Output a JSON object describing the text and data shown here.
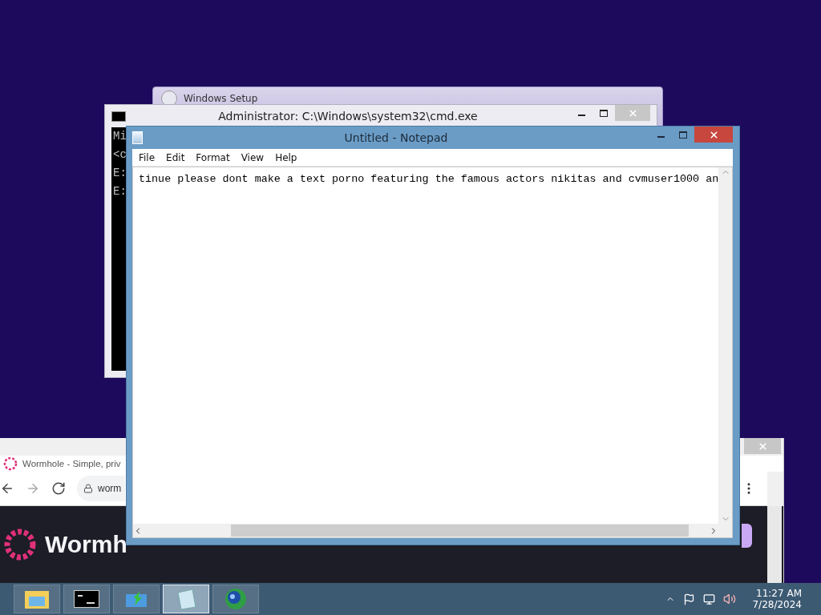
{
  "setup_window": {
    "title": "Windows Setup"
  },
  "cmd_window": {
    "title": "Administrator: C:\\Windows\\system32\\cmd.exe",
    "lines": [
      "Mi",
      "<c",
      "E:",
      "E:"
    ]
  },
  "browser_window": {
    "tab_title": "Wormhole - Simple, priv",
    "address": "worm",
    "brand": "Wormh"
  },
  "notepad": {
    "title": "Untitled - Notepad",
    "menu": [
      "File",
      "Edit",
      "Format",
      "View",
      "Help"
    ],
    "text": "tinue please dont make a text porno featuring the famous actors nikitas and cvmuser1000 an"
  },
  "taskbar": {
    "items": [
      {
        "kind": "explorer",
        "selected": false
      },
      {
        "kind": "console",
        "selected": false
      },
      {
        "kind": "setup",
        "selected": false
      },
      {
        "kind": "notepad",
        "selected": true
      },
      {
        "kind": "browser",
        "selected": false
      }
    ],
    "time": "11:27 AM",
    "date": "7/28/2024"
  }
}
